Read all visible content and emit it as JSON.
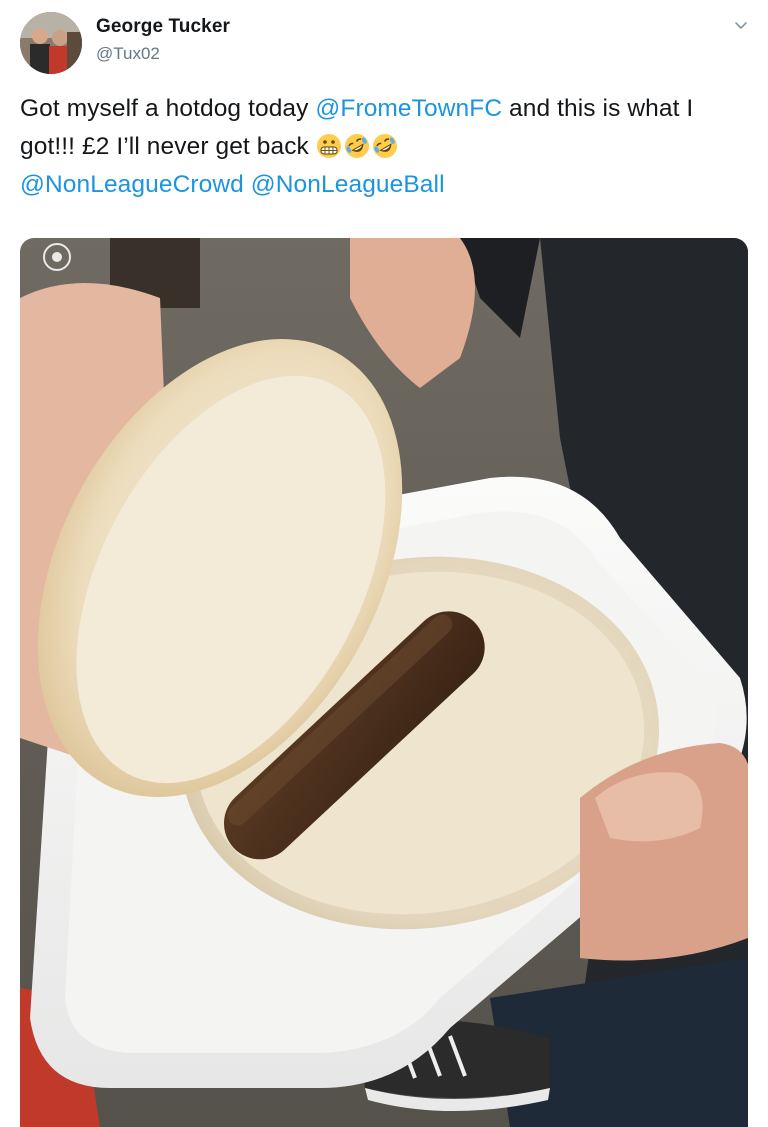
{
  "author": {
    "name": "George Tucker",
    "handle": "@Tux02",
    "avatar_icon": "profile-photo"
  },
  "tweet": {
    "text_1": "Got myself a hotdog today ",
    "mention_1": "@FromeTownFC",
    "text_2": " and this is what I got!!! £2 I’ll never get back ",
    "emojis": [
      "grimacing-face",
      "rolling-on-floor-laughing",
      "rolling-on-floor-laughing"
    ],
    "mention_2": "@NonLeagueCrowd",
    "text_3": " ",
    "mention_3": "@NonLeagueBall"
  },
  "menu": {
    "icon": "chevron-down-icon"
  },
  "media": {
    "icon": "photo-watermark-icon"
  },
  "colors": {
    "link": "#1b95e0",
    "text": "#14171a",
    "secondary": "#657786"
  }
}
